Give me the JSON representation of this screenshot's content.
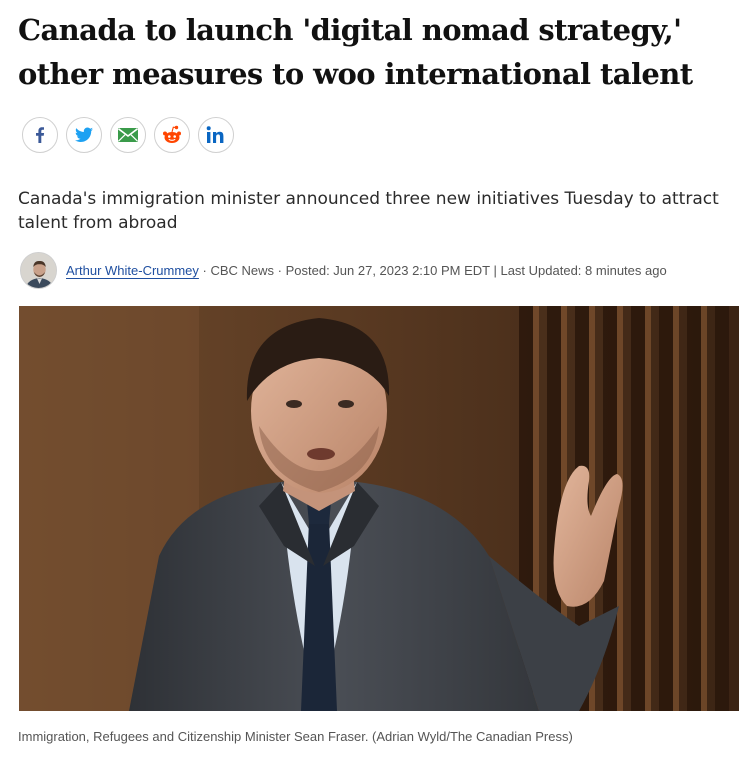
{
  "article": {
    "headline": "Canada to launch 'digital nomad strategy,' other measures to woo international talent",
    "deck": "Canada's immigration minister announced three new initiatives Tuesday to attract talent from abroad",
    "byline": {
      "author": "Arthur White-Crummey",
      "source": " · CBC News · Posted: Jun 27, 2023 2:10 PM EDT | Last Updated: 8 minutes ago"
    },
    "image_caption": "Immigration, Refugees and Citizenship Minister Sean Fraser. (Adrian Wyld/The Canadian Press)"
  },
  "share": {
    "buttons": [
      {
        "icon": "facebook-icon",
        "color": "#3b5998"
      },
      {
        "icon": "twitter-icon",
        "color": "#1da1f2"
      },
      {
        "icon": "email-icon",
        "color": "#3a9b4a"
      },
      {
        "icon": "reddit-icon",
        "color": "#ff4500"
      },
      {
        "icon": "linkedin-icon",
        "color": "#0a66c2"
      }
    ]
  }
}
